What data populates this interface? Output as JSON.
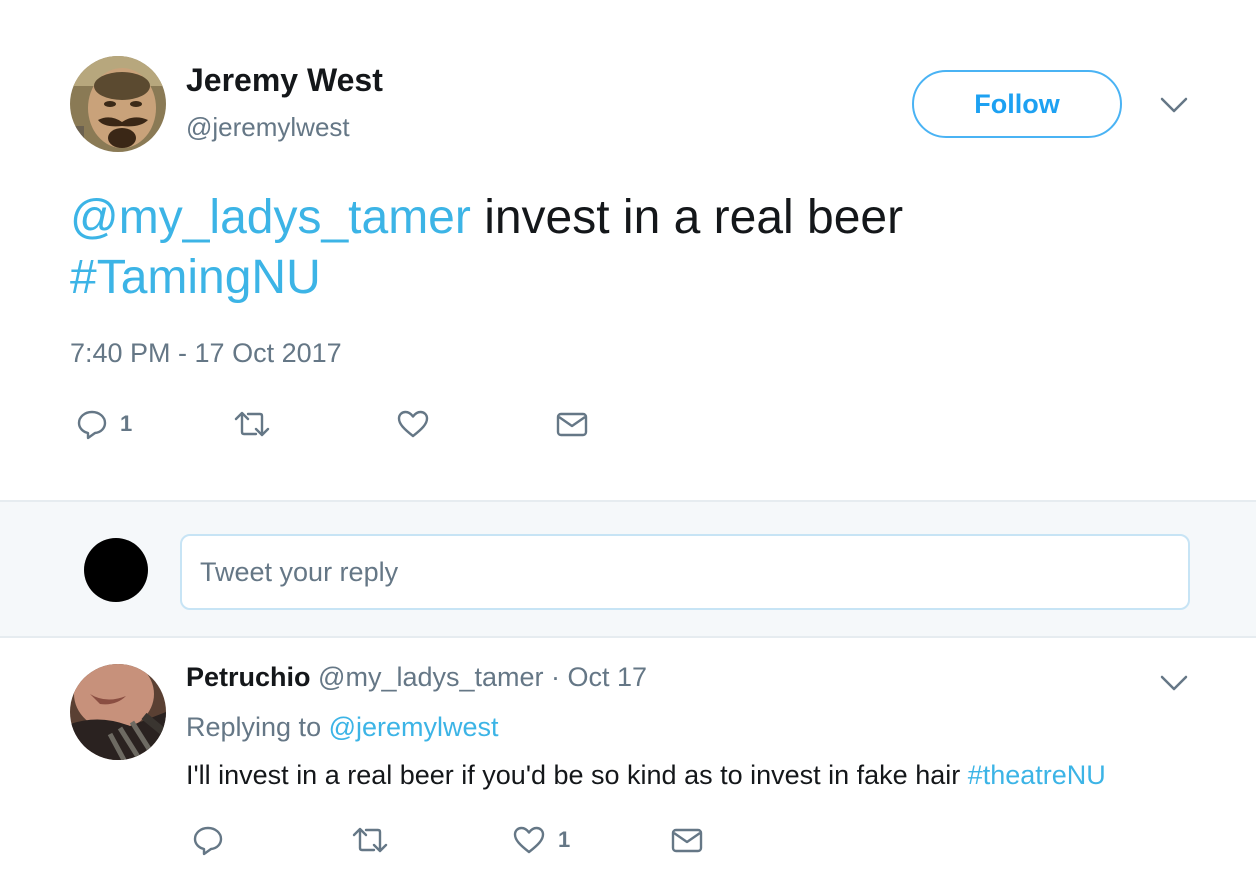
{
  "main_tweet": {
    "author_name": "Jeremy West",
    "author_handle": "@jeremylwest",
    "follow_label": "Follow",
    "text_mention": "@my_ladys_tamer",
    "text_body": " invest in a real beer ",
    "text_hashtag": "#TamingNU",
    "timestamp": "7:40 PM - 17 Oct 2017",
    "reply_count": "1",
    "icons": {
      "reply": "reply-icon",
      "retweet": "retweet-icon",
      "like": "heart-icon",
      "dm": "envelope-icon",
      "menu": "chevron-down-icon"
    }
  },
  "reply_composer": {
    "placeholder": "Tweet your reply"
  },
  "reply_tweet": {
    "author_name": "Petruchio",
    "author_handle": "@my_ladys_tamer",
    "separator": " · ",
    "date": "Oct 17",
    "replying_prefix": "Replying to ",
    "replying_handle": "@jeremylwest",
    "text_body": "I'll invest in a real beer if you'd be so kind as to invest in fake hair ",
    "text_hashtag": "#theatreNU",
    "like_count": "1"
  },
  "colors": {
    "accent": "#1da1f2",
    "text": "#14171a",
    "secondary": "#657786",
    "composer_bg": "#f5f8fa"
  }
}
